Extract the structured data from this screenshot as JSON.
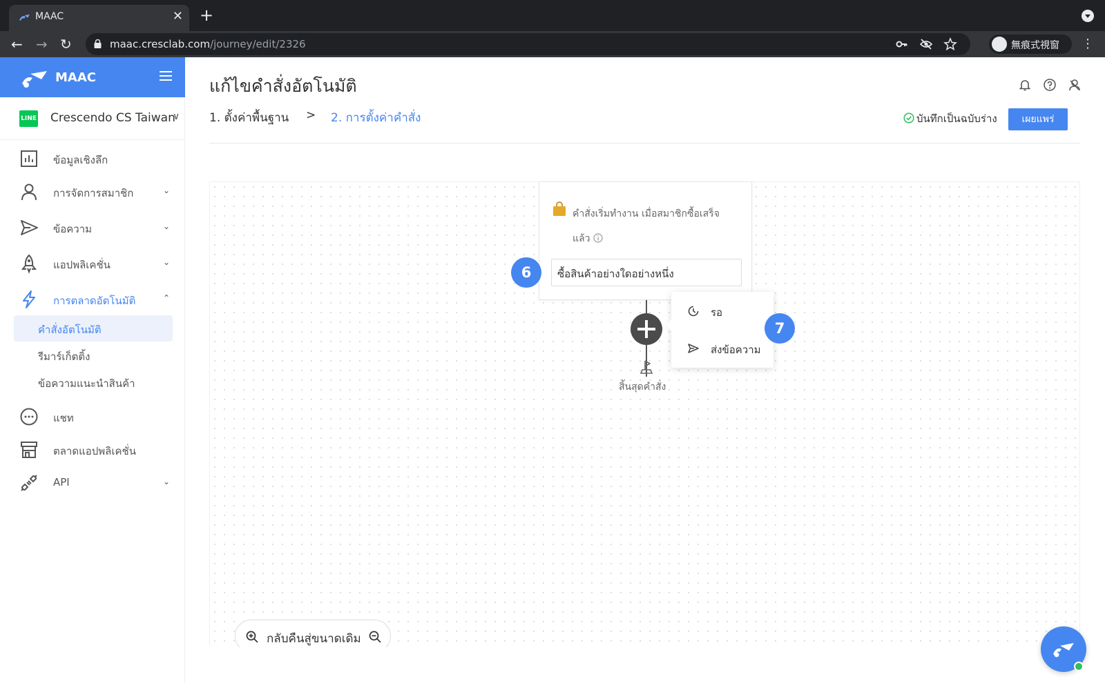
{
  "browser": {
    "tab_title": "MAAC",
    "tab_close": "✕",
    "new_tab": "+",
    "url_host": "maac.cresclab.com",
    "url_path": "/journey/edit/2326",
    "profile_label": "無痕式視窗",
    "back": "←",
    "forward": "→",
    "reload": "↻",
    "menu": "⋮"
  },
  "sidebar": {
    "brand": "MAAC",
    "account_badge": "LINE",
    "account_name": "Crescendo CS Taiwan",
    "account_chevron": "∨",
    "items": [
      {
        "label": "ข้อมูลเชิงลึก",
        "icon": "insights-chart-icon",
        "chevron": ""
      },
      {
        "label": "การจัดการสมาชิก",
        "icon": "member-icon",
        "chevron": "⌄"
      },
      {
        "label": "ข้อความ",
        "icon": "send-icon",
        "chevron": "⌄"
      },
      {
        "label": "แอปพลิเคชั่น",
        "icon": "rocket-icon",
        "chevron": "⌄"
      },
      {
        "label": "การตลาดอัตโนมัติ",
        "icon": "lightning-icon",
        "chevron": "⌃"
      },
      {
        "label": "แชท",
        "icon": "chat-icon",
        "chevron": ""
      },
      {
        "label": "ตลาดแอปพลิเคชั่น",
        "icon": "store-icon",
        "chevron": ""
      },
      {
        "label": "API",
        "icon": "api-plug-icon",
        "chevron": "⌄"
      }
    ],
    "sub_items": [
      {
        "label": "คำสั่งอัตโนมัติ"
      },
      {
        "label": "รีมาร์เก็ตติ้ง"
      },
      {
        "label": "ข้อความแนะนำสินค้า"
      }
    ]
  },
  "main": {
    "title": "แก้ไขคำสั่งอัตโนมัติ",
    "step1": "1. ตั้งค่าพื้นฐาน",
    "step_separator": ">",
    "step2": "2. การตั้งค่าคำสั่ง",
    "saved_status": "บันทึกเป็นฉบับร่าง",
    "publish_label": "เผยแพร่",
    "colors": {
      "accent": "#4586f0",
      "line_green": "#06c755",
      "bag": "#e3a92b"
    }
  },
  "canvas": {
    "trigger_line1": "คำสั่งเริ่มทำงาน เมื่อสมาชิกซื้อเสร็จ",
    "trigger_line2": "แล้ว",
    "trigger_value": "ซื้อสินค้าอย่างใดอย่างหนึ่ง",
    "badge_6": "6",
    "badge_7": "7",
    "menu": [
      {
        "label": "รอ",
        "icon": "clock-icon"
      },
      {
        "label": "ส่งข้อความ",
        "icon": "send-icon"
      }
    ],
    "end_label": "สิ้นสุดคำสั่ง",
    "zoom_label": "กลับคืนสู่ขนาดเดิม"
  }
}
